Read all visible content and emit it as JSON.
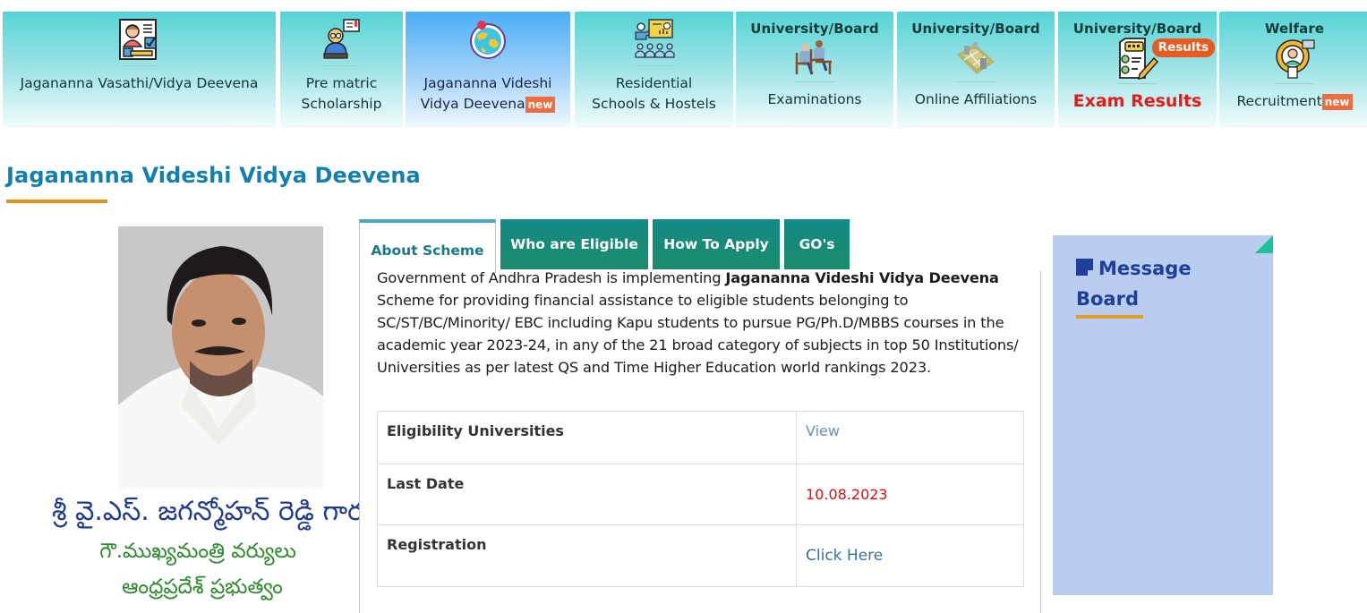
{
  "nav": {
    "cards": [
      {
        "head": "",
        "label_line1": "Jagananna Vasathi/Vidya Deevena",
        "label_line2": "",
        "icon": "application-form-icon"
      },
      {
        "head": "",
        "label_line1": "Pre matric",
        "label_line2": "Scholarship",
        "icon": "student-reading-icon"
      },
      {
        "head": "",
        "label_line1": "Jagananna Videshi",
        "label_line2": "Vidya Deevena",
        "badge": "new",
        "icon": "globe-icon",
        "active": true
      },
      {
        "head": "",
        "label_line1": "Residential",
        "label_line2": "Schools & Hostels",
        "icon": "classroom-icon"
      },
      {
        "head": "University/Board",
        "label_line1": "Examinations",
        "icon": "exam-students-icon"
      },
      {
        "head": "University/Board",
        "label_line1": "Online Affiliations",
        "icon": "campus-map-icon"
      },
      {
        "head": "University/Board",
        "label_line1": "Exam Results",
        "badge": "Results",
        "icon": "result-sheet-icon"
      },
      {
        "head": "Welfare",
        "label_line1": "Recruitment",
        "badge": "new",
        "icon": "recruitment-gear-icon"
      }
    ]
  },
  "page": {
    "title": "Jagananna Videshi Vidya Deevena"
  },
  "profile": {
    "photo_alt": "Chief Minister portrait",
    "caption_line1": "శ్రీ వై.ఎస్. జగన్మోహన్ రెడ్డి గారు",
    "caption_line2": "గౌ.ముఖ్యమంత్రి వర్యులు",
    "caption_line3": "ఆంధ్రప్రదేశ్ ప్రభుత్వం"
  },
  "tabs": [
    {
      "label": "About Scheme",
      "active": true
    },
    {
      "label": "Who are Eligible"
    },
    {
      "label": "How To Apply"
    },
    {
      "label": "GO's"
    }
  ],
  "about": {
    "intro": "Government of Andhra Pradesh is implementing ",
    "scheme_name": "Jagananna Videshi Vidya Deevena",
    "body": " Scheme for providing financial assistance to eligible students belonging to SC/ST/BC/Minority/ EBC including Kapu students to pursue PG/Ph.D/MBBS courses in the academic year 2023-24, in any of the 21 broad category of subjects in top 50 Institutions/ Universities as per latest QS and Time Higher Education world rankings 2023."
  },
  "info_table": {
    "rows": [
      {
        "key": "Eligibility Universities",
        "value": "View"
      },
      {
        "key": "Last Date",
        "value": "10.08.2023"
      },
      {
        "key": "Registration",
        "value": "Click Here"
      }
    ]
  },
  "message_board": {
    "title_line1": "Message",
    "title_line2": "Board"
  },
  "colors": {
    "title_blue": "#137fae",
    "accent_orange": "#de8f21",
    "tab_green": "#138a86",
    "date_red": "#d81010",
    "board_bg": "#b8cdef",
    "results_red": "#e31b1b"
  }
}
